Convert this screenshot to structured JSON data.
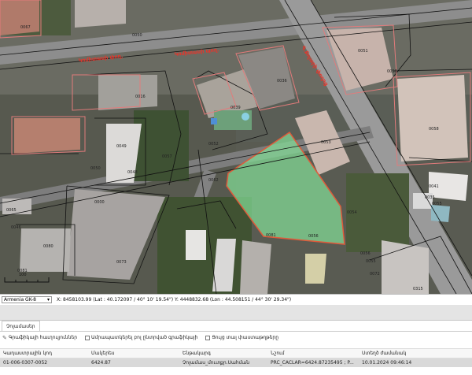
{
  "coordbar": {
    "crs": "Armenia GK-8",
    "coords": "X: 8458103.99 (Lat : 40.172097 / 40° 10' 19.54\")  Y: 4448832.68 (Lon : 44.508151 / 44° 30' 29.34\")"
  },
  "panel": {
    "tab_label": "Չոլամասեր",
    "toolbar": {
      "layers_label": "Գրաֆիկայի հաւղուլյուններ",
      "show_all_label": "Ամրապատկերել բոլ ընտրված գրաֆիկայի",
      "extra_label": "Ցույց տալ փաստաթղթերը"
    },
    "columns": [
      "Կադաստրային կոդ",
      "Մակերես",
      "Ենթակարգ",
      "Նշում",
      "Ստեղծ ժամանակ"
    ],
    "rows": [
      [
        "01-006-0307-0052",
        "6424.87",
        "Չոլամաս_մուտքր.Սահման",
        "PRC_CACLAR=6424.87235495 ; P...",
        "10.01.2024 09:46:14"
      ]
    ]
  },
  "map": {
    "street_labels": [
      "Կոմիտասի փող.",
      "Կոմիտասի պող.",
      "Գ.Քոչարի փողոց"
    ],
    "parcel_labels": [
      "0067",
      "0050",
      "0051",
      "0058",
      "0036",
      "0016",
      "0039",
      "0053",
      "0049",
      "0058",
      "0052",
      "0050",
      "0048",
      "0057",
      "0054",
      "0041",
      "0035",
      "0055",
      "0081",
      "0056",
      "0062",
      "0073",
      "0080",
      "0081",
      "0072",
      "0315",
      "0056",
      "0055",
      "0000",
      "0046",
      "0065"
    ],
    "scale_label": "100"
  }
}
